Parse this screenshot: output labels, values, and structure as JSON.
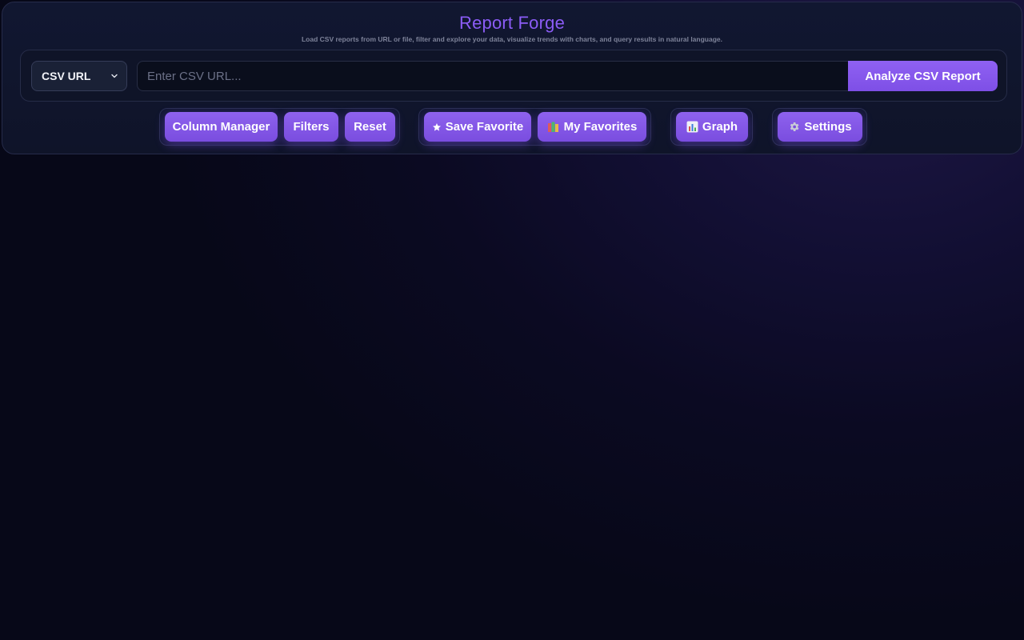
{
  "header": {
    "title": "Report Forge",
    "subtitle": "Load CSV reports from URL or file, filter and explore your data, visualize trends with charts, and query results in natural language."
  },
  "source": {
    "selected": "CSV URL",
    "url_value": "",
    "url_placeholder": "Enter CSV URL...",
    "analyze_label": "Analyze CSV Report"
  },
  "toolbar": {
    "column_manager": "Column Manager",
    "filters": "Filters",
    "reset": "Reset",
    "save_favorite": "Save Favorite",
    "my_favorites": "My Favorites",
    "graph": "Graph",
    "settings": "Settings"
  },
  "icons": {
    "source_select": "chevron-down-icon",
    "save_favorite": "star-icon",
    "my_favorites": "books-icon",
    "graph": "bar-chart-icon",
    "settings": "gear-icon"
  },
  "colors": {
    "accent": "#8b5cf6",
    "button": "#8e62ee",
    "panel": "#111731",
    "background": "#0a0a20"
  }
}
